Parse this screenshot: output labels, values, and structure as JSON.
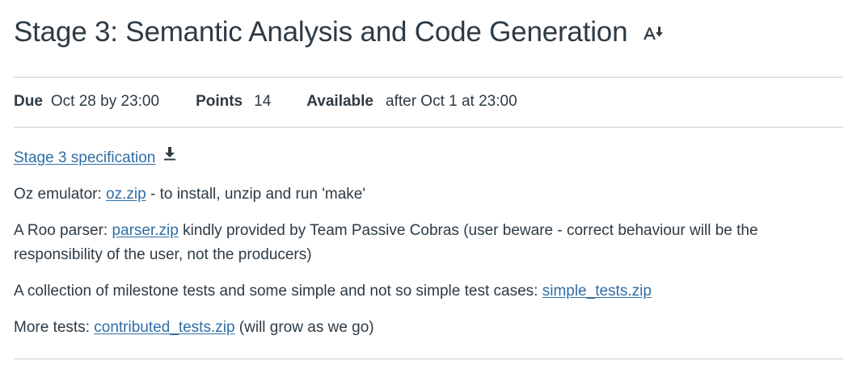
{
  "assignment": {
    "title": "Stage 3: Semantic Analysis and Code Generation",
    "details": {
      "due_label": "Due",
      "due_value": "Oct 28 by 23:00",
      "points_label": "Points",
      "points_value": "14",
      "available_label": "Available",
      "available_value": "after Oct 1 at 23:00"
    },
    "description": {
      "spec_link": "Stage 3 specification",
      "oz_prefix": "Oz emulator: ",
      "oz_link": "oz.zip",
      "oz_suffix": " - to install, unzip and run 'make'",
      "parser_prefix": "A Roo parser: ",
      "parser_link": "parser.zip",
      "parser_suffix": " kindly provided by Team Passive Cobras (user beware - correct behaviour will be the responsibility of the user, not the producers)",
      "tests_prefix": "A collection of milestone tests and some simple and not so simple test cases: ",
      "tests_link": "simple_tests.zip",
      "more_prefix": "More tests: ",
      "more_link": "contributed_tests.zip",
      "more_suffix": " (will grow as we go)"
    }
  },
  "icons": {
    "immersive_reader": "immersive-reader-icon",
    "download": "download-icon"
  },
  "colors": {
    "text": "#2d3b45",
    "link": "#2f6ea7",
    "divider": "#c7cdd1"
  }
}
